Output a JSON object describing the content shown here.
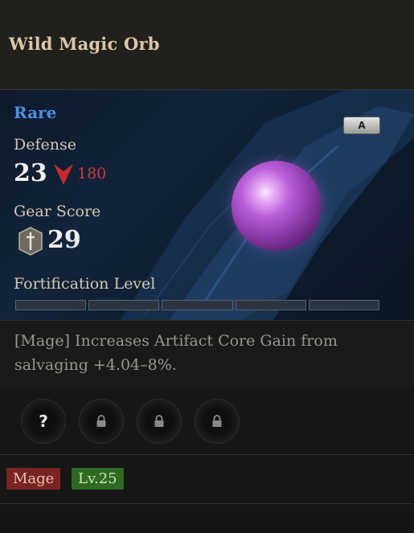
{
  "item": {
    "name": "Wild Magic Orb",
    "rarity": "Rare",
    "grade_badge": "A",
    "defense": {
      "label": "Defense",
      "value": "23",
      "comparison": "180",
      "comparison_direction": "down"
    },
    "gear_score": {
      "label": "Gear Score",
      "value": "29",
      "icon": "gear-score-shield-icon"
    },
    "fortification": {
      "label": "Fortification Level",
      "segments": 5,
      "filled": 0
    },
    "description": "[Mage] Increases Artifact Core Gain from salvaging +4.04–8%.",
    "sockets": [
      {
        "type": "unknown",
        "glyph": "?"
      },
      {
        "type": "locked",
        "glyph": ""
      },
      {
        "type": "locked",
        "glyph": ""
      },
      {
        "type": "locked",
        "glyph": ""
      }
    ],
    "tags": {
      "class": "Mage",
      "level": "Lv.25"
    }
  },
  "colors": {
    "rarity": "#4f8fe6",
    "decrease": "#d23a3a",
    "class_tag": "#7a2323",
    "level_tag": "#2e6a22"
  }
}
